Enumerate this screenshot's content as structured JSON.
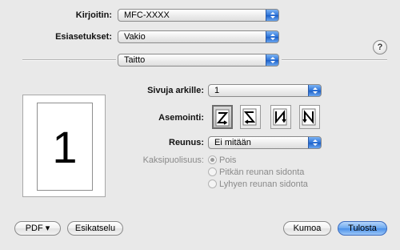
{
  "printer": {
    "label": "Kirjoitin:",
    "value": "MFC-XXXX"
  },
  "presets": {
    "label": "Esiasetukset:",
    "value": "Vakio"
  },
  "help_label": "?",
  "section": {
    "value": "Taitto"
  },
  "preview": {
    "page_number": "1"
  },
  "layout": {
    "pages_per_sheet_label": "Sivuja arkille:",
    "pages_per_sheet_value": "1",
    "direction_label": "Asemointi:",
    "direction_buttons": [
      {
        "name": "z-direction",
        "selected": true
      },
      {
        "name": "reverse-z-direction",
        "selected": false
      },
      {
        "name": "n-direction",
        "selected": false
      },
      {
        "name": "reverse-n-direction",
        "selected": false
      }
    ],
    "border_label": "Reunus:",
    "border_value": "Ei mitään",
    "two_sided_label": "Kaksipuolisuus:",
    "two_sided_options": [
      {
        "label": "Pois",
        "checked": true
      },
      {
        "label": "Pitkän reunan sidonta",
        "checked": false
      },
      {
        "label": "Lyhyen reunan sidonta",
        "checked": false
      }
    ]
  },
  "buttons": {
    "pdf": "PDF ▾",
    "preview": "Esikatselu",
    "cancel": "Kumoa",
    "print": "Tulosta"
  },
  "colors": {
    "popup_arrow": "#2d74d8",
    "default_button": "#6aa7ef",
    "background": "#e9e9e9"
  }
}
